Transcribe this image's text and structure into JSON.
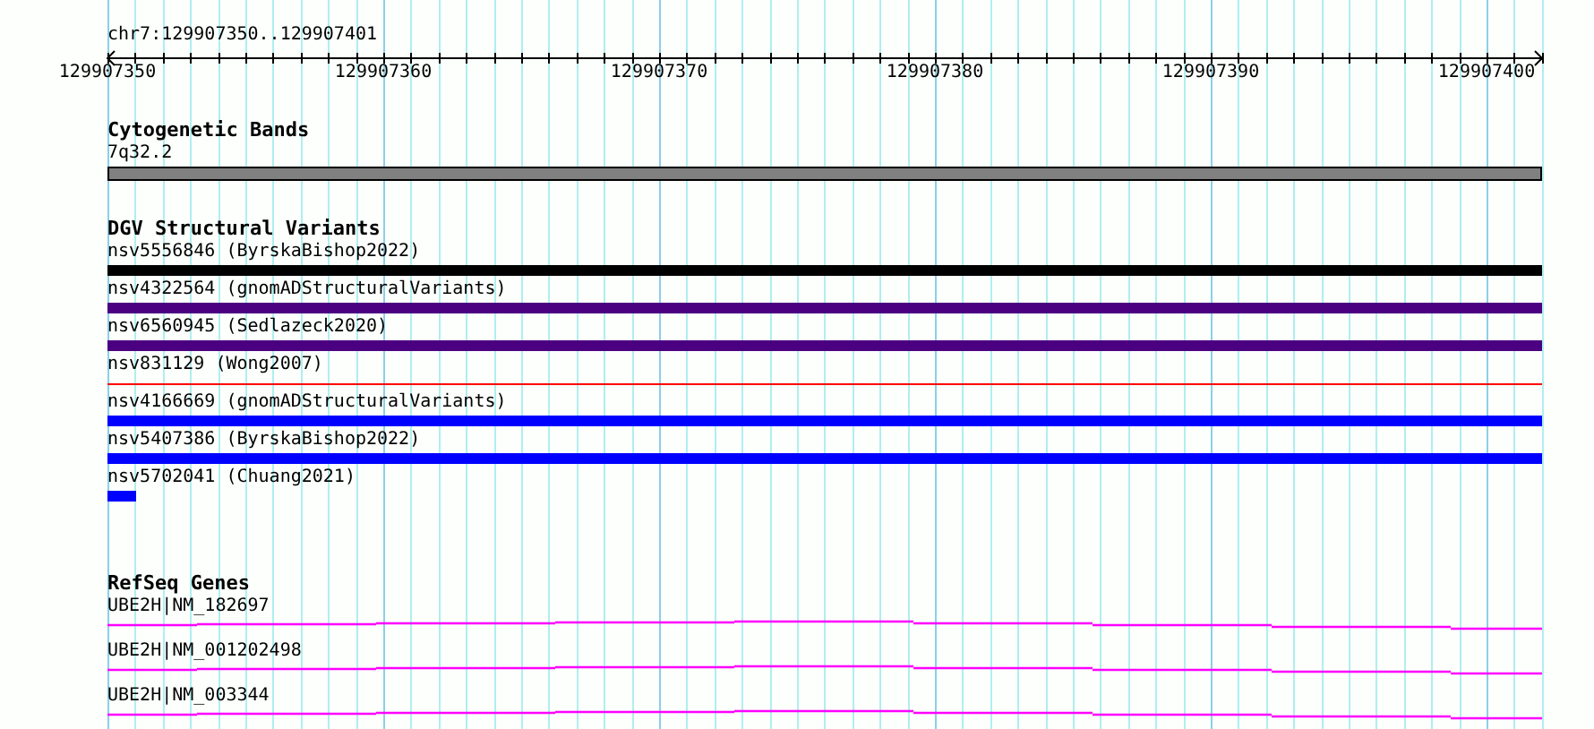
{
  "ruler": {
    "region": "chr7:129907350..129907401",
    "tick_labels": [
      "129907350",
      "129907360",
      "129907370",
      "129907380",
      "129907390",
      "129907400"
    ]
  },
  "tracks": [
    {
      "kind": "bands",
      "title": "Cytogenetic Bands",
      "features": [
        {
          "label": "7q32.2",
          "kind": "band",
          "color": "#808080"
        }
      ]
    },
    {
      "kind": "variants",
      "title": "DGV Structural Variants",
      "features": [
        {
          "label": "nsv5556846 (ByrskaBishop2022)",
          "kind": "thick",
          "color": "#000000"
        },
        {
          "label": "nsv4322564 (gnomADStructuralVariants)",
          "kind": "thick",
          "color": "#4b0082"
        },
        {
          "label": "nsv6560945 (Sedlazeck2020)",
          "kind": "thick",
          "color": "#4b0082"
        },
        {
          "label": "nsv831129 (Wong2007)",
          "kind": "thin",
          "color": "#ff0000"
        },
        {
          "label": "nsv4166669 (gnomADStructuralVariants)",
          "kind": "thick",
          "color": "#0000ff"
        },
        {
          "label": "nsv5407386 (ByrskaBishop2022)",
          "kind": "thick",
          "color": "#0000ff"
        },
        {
          "label": "nsv5702041 (Chuang2021)",
          "kind": "stub",
          "color": "#0000ff"
        }
      ]
    },
    {
      "kind": "genes",
      "title": "RefSeq Genes",
      "features": [
        {
          "label": "UBE2H|NM_182697",
          "kind": "intron",
          "color": "#ff00ff"
        },
        {
          "label": "UBE2H|NM_001202498",
          "kind": "intron",
          "color": "#ff00ff"
        },
        {
          "label": "UBE2H|NM_003344",
          "kind": "intron",
          "color": "#ff00ff"
        }
      ]
    }
  ]
}
